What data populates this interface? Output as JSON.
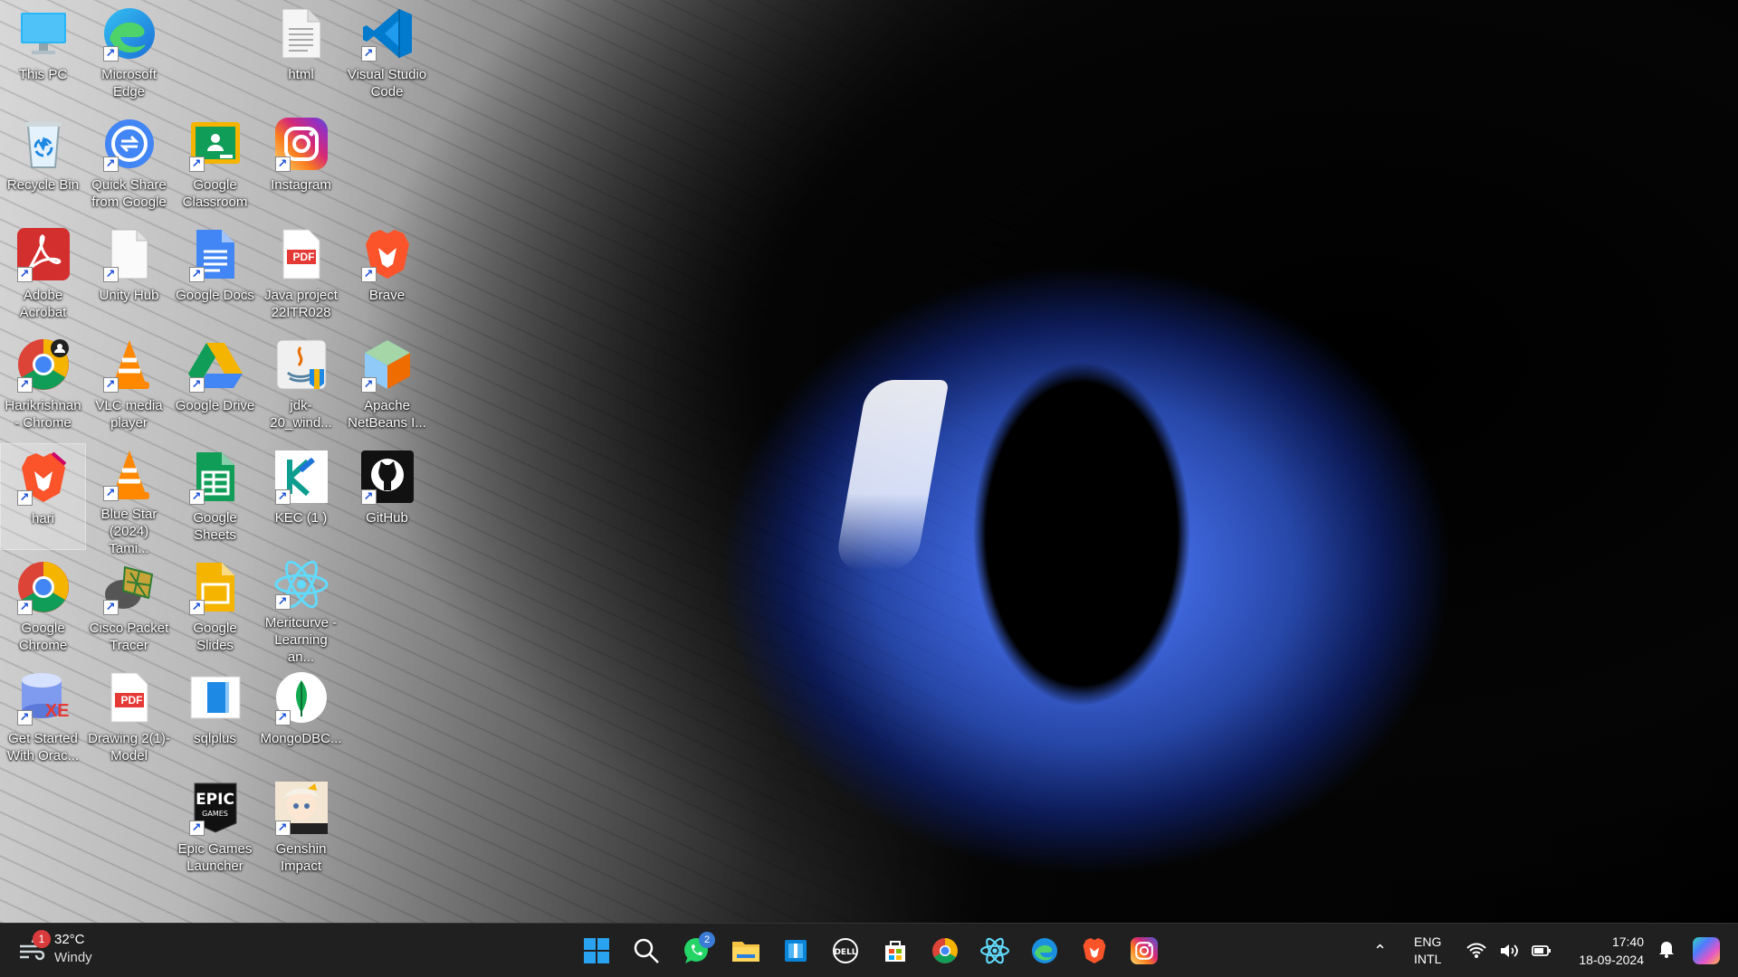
{
  "desktop": {
    "icons": [
      {
        "label": "This PC"
      },
      {
        "label": "Microsoft Edge"
      },
      {
        "label": "html"
      },
      {
        "label": "Visual Studio Code"
      },
      {
        "label": "Recycle Bin"
      },
      {
        "label": "Quick Share from Google"
      },
      {
        "label": "Google Classroom"
      },
      {
        "label": "Instagram"
      },
      {
        "label": "Adobe Acrobat"
      },
      {
        "label": "Unity Hub"
      },
      {
        "label": "Google Docs"
      },
      {
        "label": "Java project 22ITR028"
      },
      {
        "label": "Brave"
      },
      {
        "label": "Harikrishnan - Chrome"
      },
      {
        "label": "VLC media player"
      },
      {
        "label": "Google Drive"
      },
      {
        "label": "jdk-20_wind..."
      },
      {
        "label": "Apache NetBeans I..."
      },
      {
        "label": "hari"
      },
      {
        "label": "Blue Star (2024) Tami..."
      },
      {
        "label": "Google Sheets"
      },
      {
        "label": "KEC (1 )"
      },
      {
        "label": "GitHub"
      },
      {
        "label": "Google Chrome"
      },
      {
        "label": "Cisco Packet Tracer"
      },
      {
        "label": "Google Slides"
      },
      {
        "label": "Meritcurve - Learning an..."
      },
      {
        "label": "Get Started With Orac..."
      },
      {
        "label": "Drawing 2(1)-Model"
      },
      {
        "label": "sqlplus"
      },
      {
        "label": "MongoDBC..."
      },
      {
        "label": "Epic Games Launcher"
      },
      {
        "label": "Genshin Impact"
      }
    ],
    "icon_glyphs": {
      "pdf": "PDF",
      "epic": "EPIC",
      "epic_sub": "GAMES",
      "xe": "XE"
    }
  },
  "taskbar": {
    "weather": {
      "temp": "32°C",
      "condition": "Windy",
      "badge": "1"
    },
    "apps": [
      {
        "name": "start-button"
      },
      {
        "name": "search-button"
      },
      {
        "name": "whatsapp-button",
        "badge": "2"
      },
      {
        "name": "file-explorer-button"
      },
      {
        "name": "widgets-app-button"
      },
      {
        "name": "dell-button"
      },
      {
        "name": "microsoft-store-button"
      },
      {
        "name": "chrome-button"
      },
      {
        "name": "react-app-button"
      },
      {
        "name": "edge-button"
      },
      {
        "name": "brave-button"
      },
      {
        "name": "instagram-button"
      }
    ],
    "tray": {
      "lang_top": "ENG",
      "lang_bottom": "INTL",
      "time": "17:40",
      "date": "18-09-2024"
    }
  },
  "colors": {
    "taskbar_bg": "#202020",
    "iris_blue": "#3d64d8",
    "accent": "#0078d4"
  }
}
